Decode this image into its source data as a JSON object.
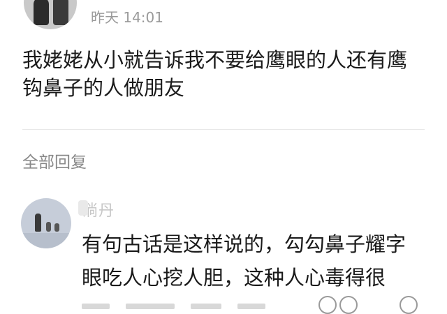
{
  "post": {
    "time": "昨天 14:01",
    "text": "我姥姥从小就告诉我不要给鹰眼的人还有鹰钩鼻子的人做朋友"
  },
  "replies_section": {
    "title": "全部回复"
  },
  "reply": {
    "username": "淌丹",
    "text": "有句古话是这样说的，勾勾鼻子耀字眼吃人心挖人胆，这种人心毒得很"
  }
}
